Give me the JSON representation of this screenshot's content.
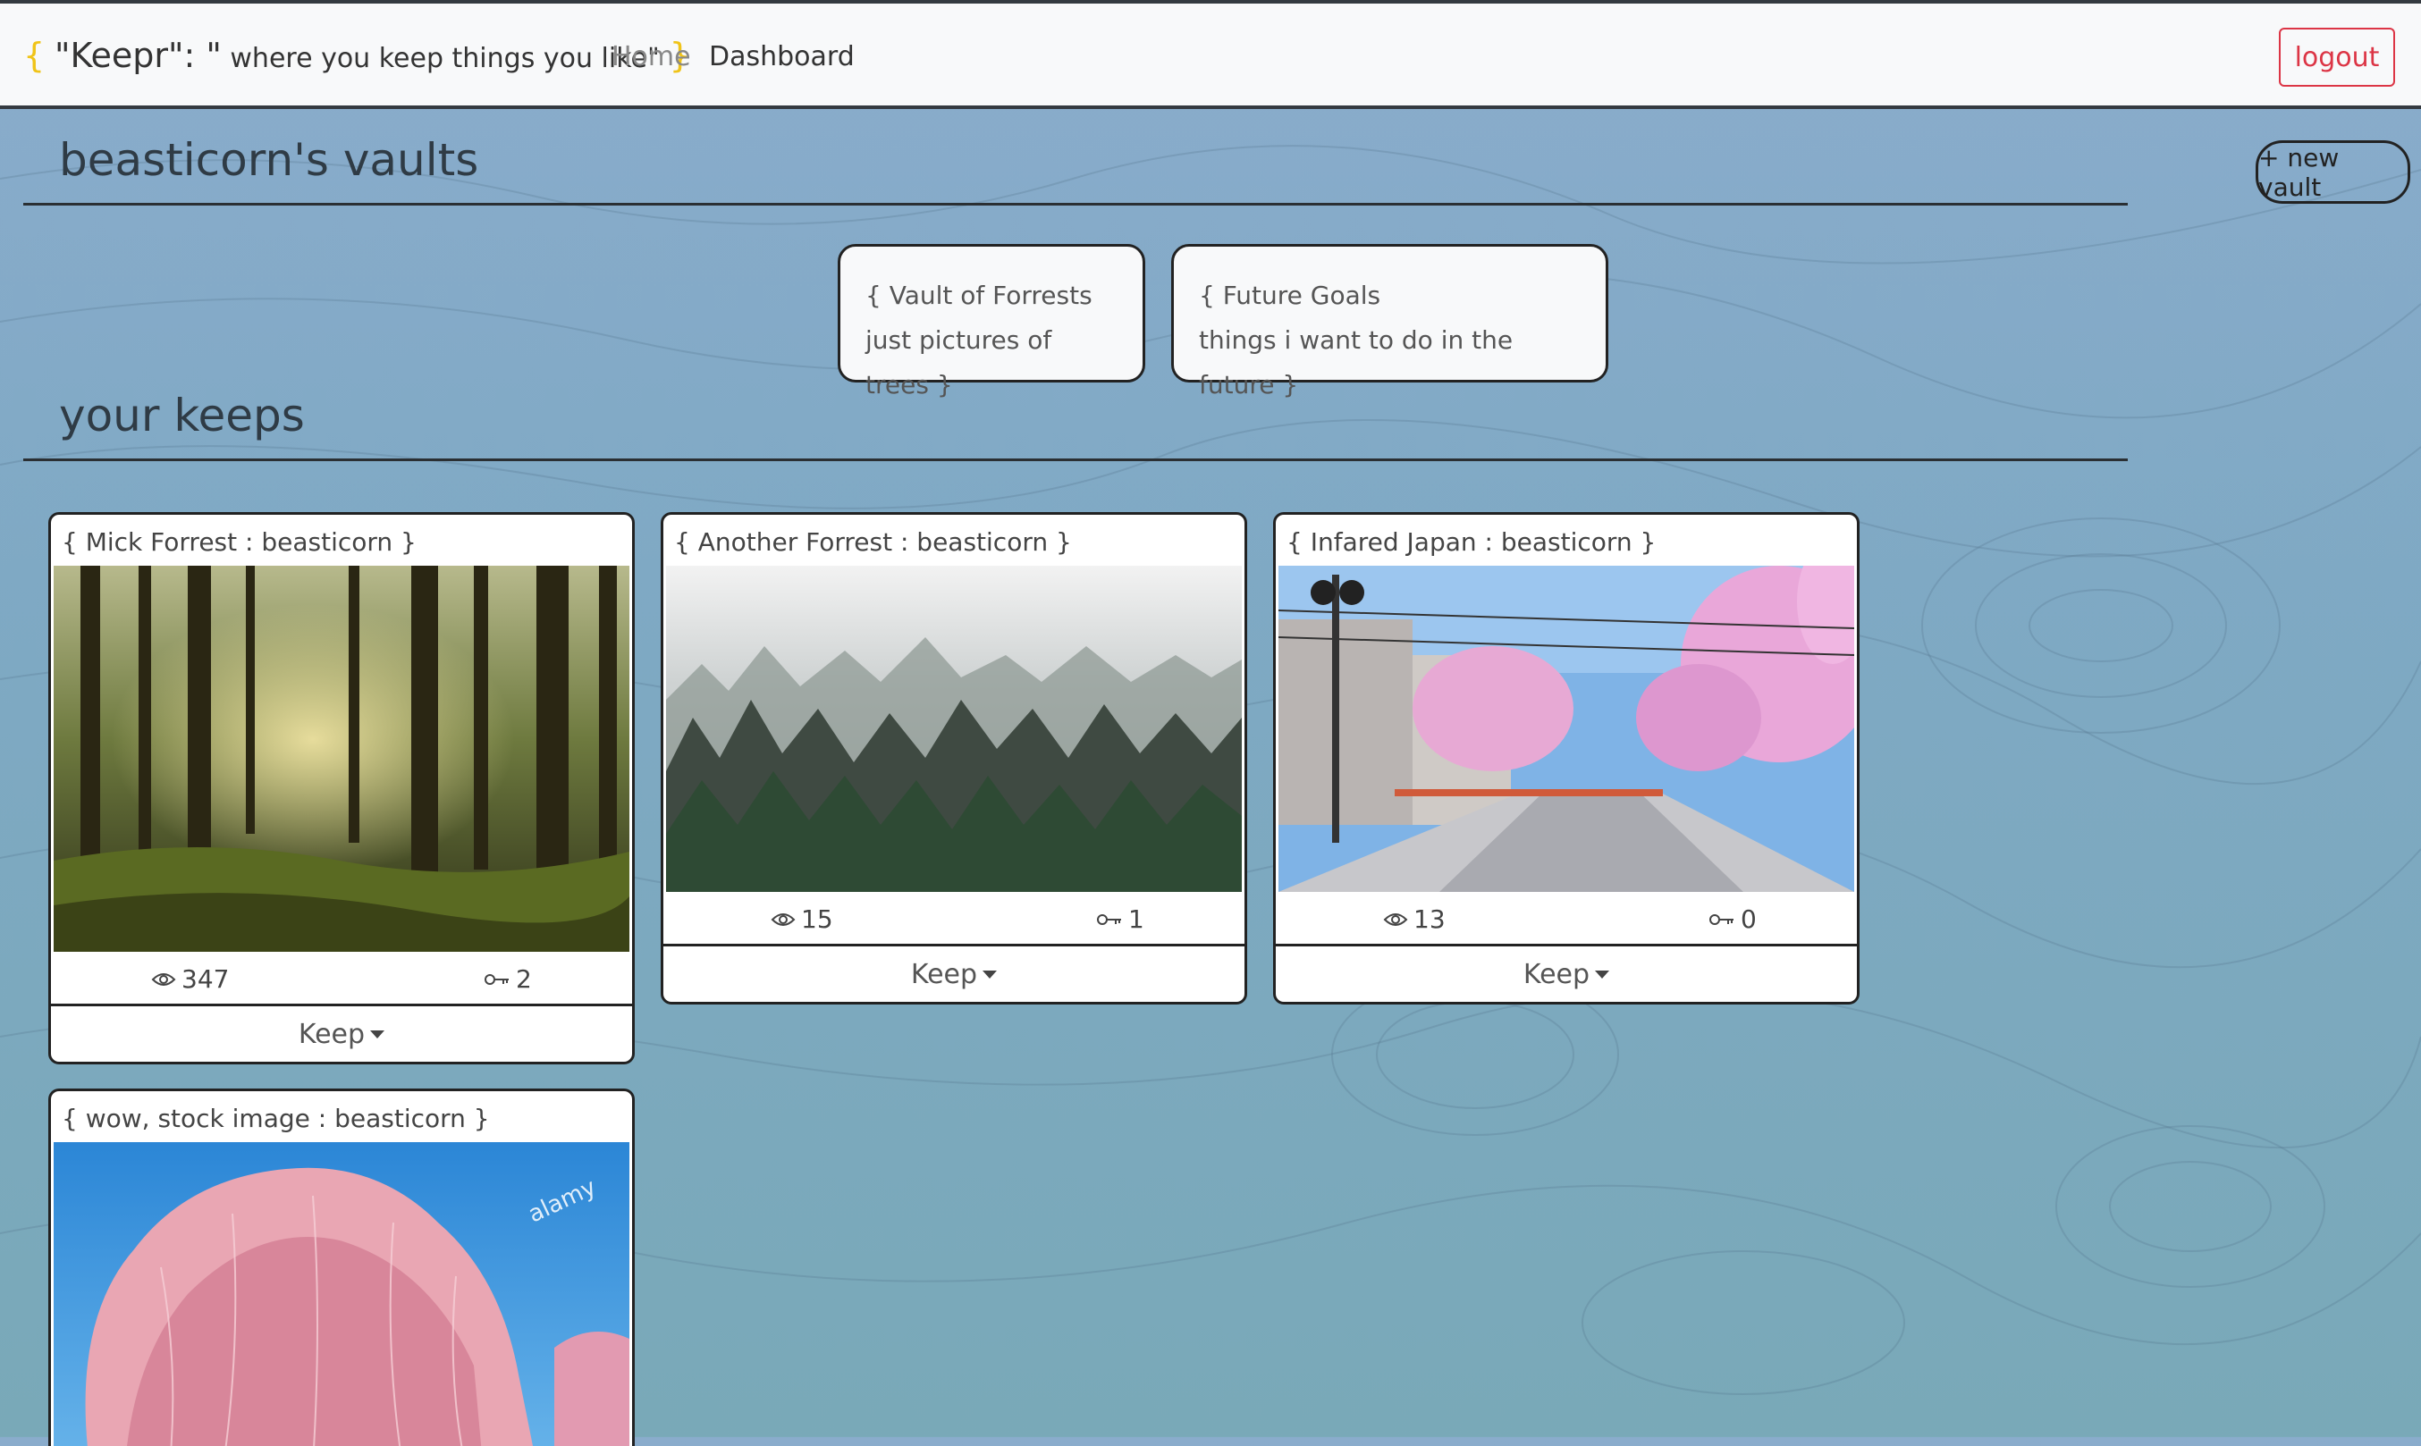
{
  "navbar": {
    "brand_open": "{",
    "brand_name": "\"Keepr\": \"",
    "brand_tagline": " where you keep things you like\"",
    "brand_close": "}",
    "home_label": "Home",
    "dashboard_label": "Dashboard",
    "logout_label": "logout"
  },
  "vaults_section": {
    "title": "beasticorn's vaults",
    "new_vault_label": "+ new vault",
    "vaults": [
      {
        "line1": "{ Vault of Forrests",
        "line2": "just pictures of trees }"
      },
      {
        "line1": "{ Future Goals",
        "line2": "things i want to do in the future }"
      }
    ]
  },
  "keeps_section": {
    "title": "your keeps",
    "keeps": [
      {
        "title": "{ Mick Forrest : beasticorn }",
        "views": "347",
        "keeps": "2",
        "button": "Keep"
      },
      {
        "title": "{ Another Forrest : beasticorn }",
        "views": "15",
        "keeps": "1",
        "button": "Keep"
      },
      {
        "title": "{ Infared Japan : beasticorn }",
        "views": "13",
        "keeps": "0",
        "button": "Keep"
      },
      {
        "title": "{ wow, stock image : beasticorn }",
        "watermark": "alamy"
      }
    ]
  },
  "icons": {
    "views": "eye-icon",
    "keeps": "key-icon",
    "dropdown": "caret-down-icon"
  },
  "colors": {
    "brace": "#f0c419",
    "logout": "#dc3545",
    "navbar_bg": "#f8f9fa"
  }
}
